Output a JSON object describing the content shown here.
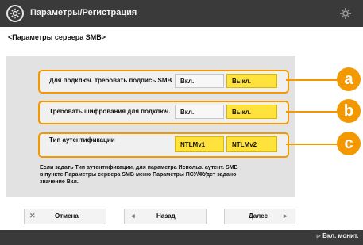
{
  "header": {
    "title": "Параметры/Регистрация",
    "settings_icon": "gear-icon"
  },
  "breadcrumb": "<Параметры сервера SMB>",
  "rows": [
    {
      "label": "Для подключ. требовать подпись SMB",
      "options": [
        {
          "label": "Вкл.",
          "selected": false
        },
        {
          "label": "Выкл.",
          "selected": true
        }
      ],
      "callout": "a"
    },
    {
      "label": "Требовать шифрования для подключ.",
      "options": [
        {
          "label": "Вкл.",
          "selected": false
        },
        {
          "label": "Выкл.",
          "selected": true
        }
      ],
      "callout": "b"
    },
    {
      "label": "Тип аутентификации",
      "options": [
        {
          "label": "NTLMv1",
          "selected": true
        },
        {
          "label": "NTLMv2",
          "selected": true
        }
      ],
      "callout": "c"
    }
  ],
  "note": [
    "Если задать Тип аутентификации, для параметра Использ. аутент. SMB",
    "в пункте Параметры сервера SMB меню Параметры ПСУ/ФУдет задано",
    "значение Вкл."
  ],
  "buttons": {
    "cancel": "Отмена",
    "back": "Назад",
    "next": "Далее"
  },
  "statusbar": {
    "right_button": "Вкл. монит."
  },
  "colors": {
    "accent": "#f39800",
    "selected": "#ffe23b",
    "titlebar": "#3a3a3a",
    "panel": "#e2e2e2"
  }
}
